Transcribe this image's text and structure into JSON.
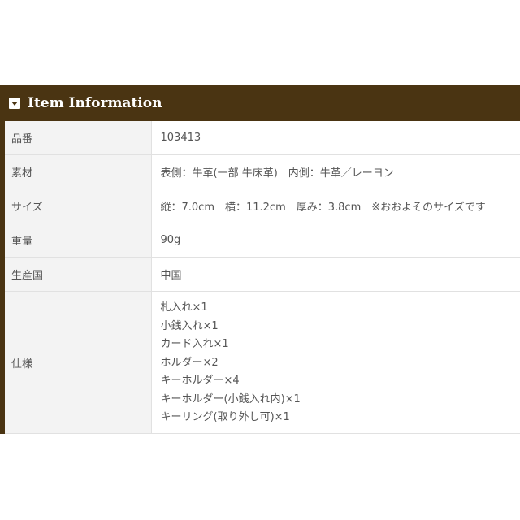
{
  "section": {
    "title": "Item Information",
    "icon": "dropdown-toggle-icon",
    "header_color": "#4a3412"
  },
  "rows": [
    {
      "key": "品番",
      "value": "103413"
    },
    {
      "key": "素材",
      "value": "表側：牛革(一部 牛床革)　内側：牛革／レーヨン"
    },
    {
      "key": "サイズ",
      "value": "縦：7.0cm　横：11.2cm　厚み：3.8cm　※おおよそのサイズです"
    },
    {
      "key": "重量",
      "value": "90g"
    },
    {
      "key": "生産国",
      "value": "中国"
    }
  ],
  "spec": {
    "key": "仕様",
    "items": [
      "札入れ×1",
      "小銭入れ×1",
      "カード入れ×1",
      "ホルダー×2",
      "キーホルダー×4",
      "キーホルダー(小銭入れ内)×1",
      "キーリング(取り外し可)×1"
    ]
  }
}
